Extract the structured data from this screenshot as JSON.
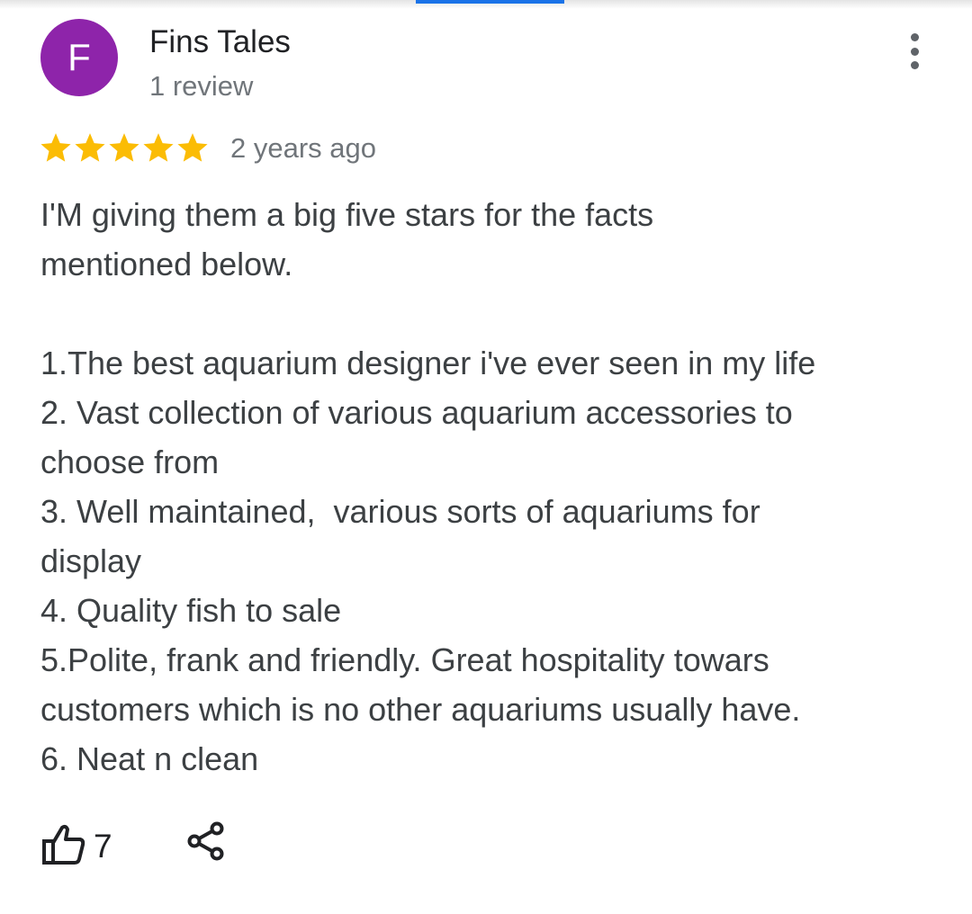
{
  "reviewer": {
    "avatar_letter": "F",
    "avatar_color": "#8e24aa",
    "name": "Fins Tales",
    "review_count": "1 review"
  },
  "review": {
    "rating": 5,
    "rating_max": 5,
    "star_color": "#fbbc04",
    "age": "2 years ago",
    "lines": [
      "I'M giving them a big five stars for the facts",
      "mentioned below.",
      "",
      "1.The best aquarium designer i've ever seen in my life",
      "2. Vast collection of various aquarium accessories to",
      "choose from",
      "3. Well maintained,  various sorts of aquariums for",
      "display",
      "4. Quality fish to sale",
      "5.Polite, frank and friendly. Great hospitality towars",
      "customers which is no other aquariums usually have.",
      "6. Neat n clean"
    ]
  },
  "actions": {
    "like_count": "7",
    "like_icon": "thumb-up-icon",
    "share_icon": "share-icon",
    "more_icon": "more-vert-icon"
  },
  "accent_color": "#1a73e8"
}
